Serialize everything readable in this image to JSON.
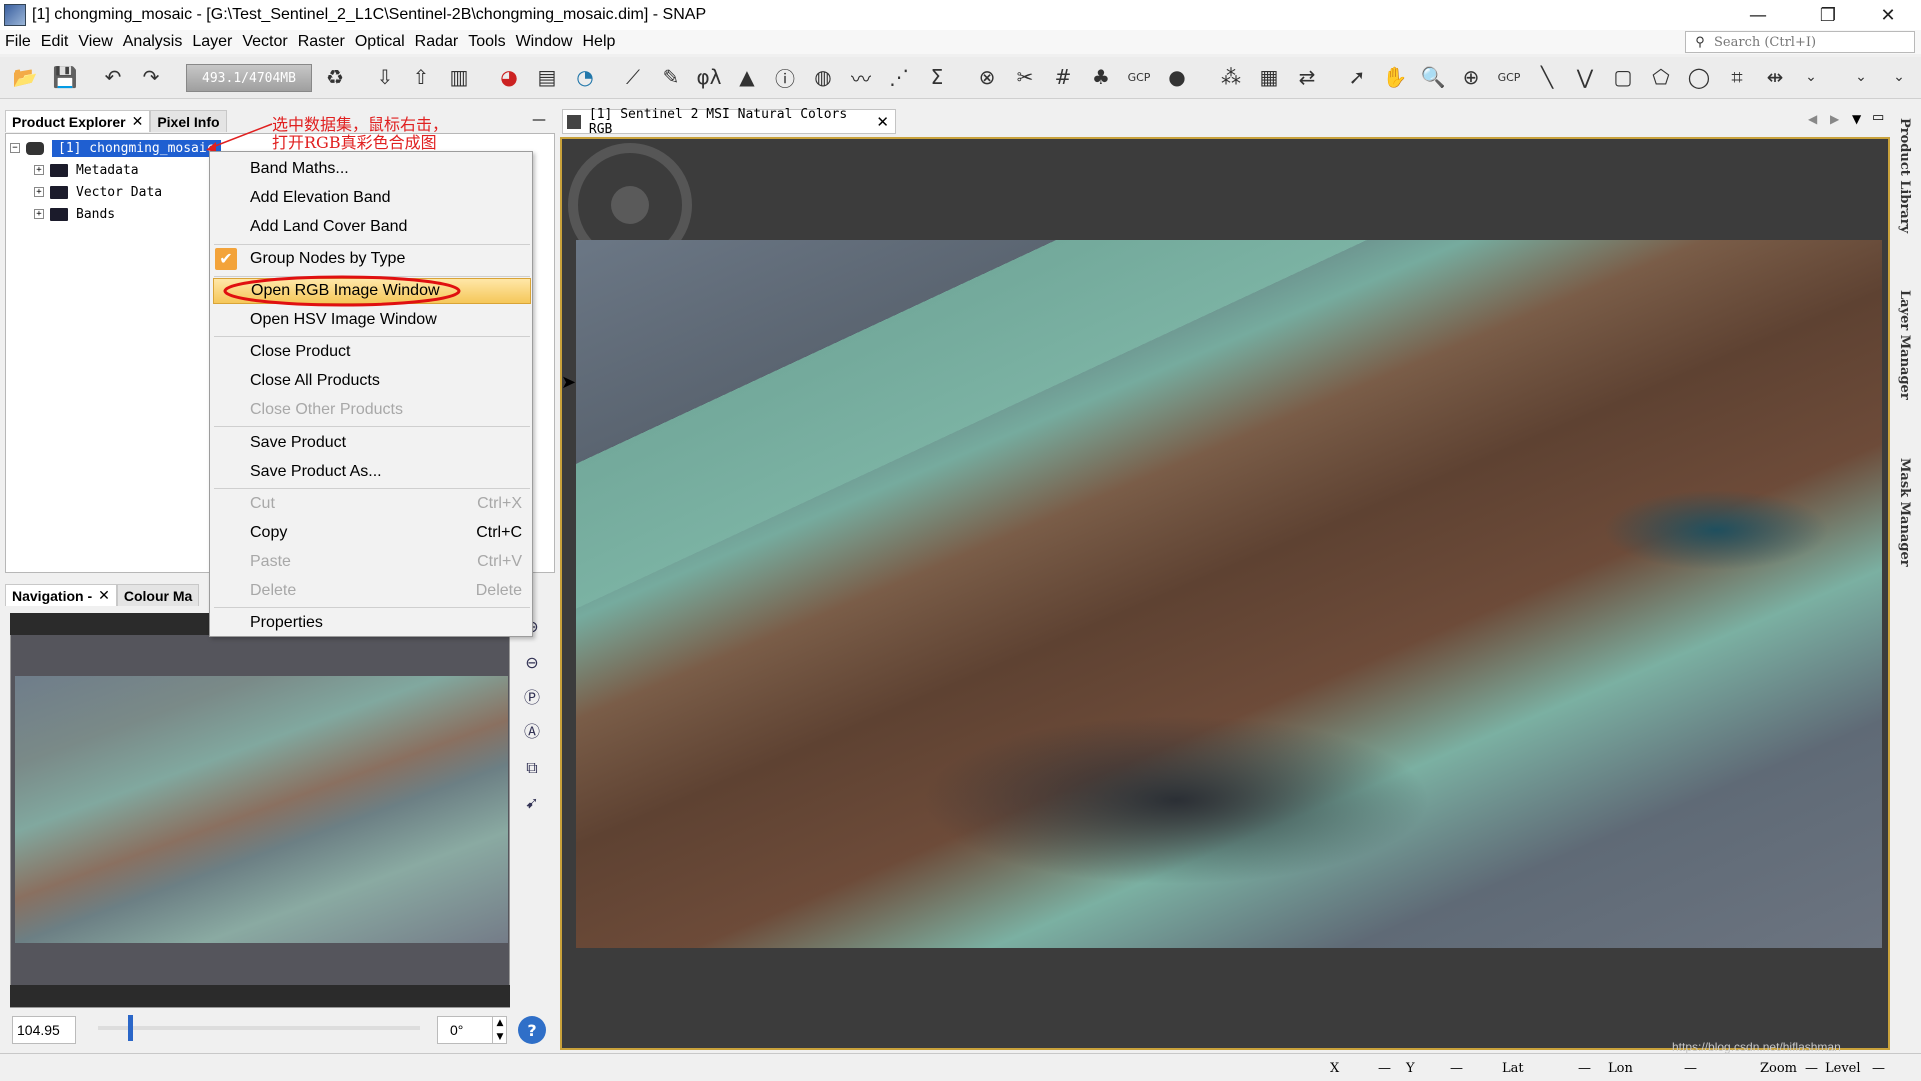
{
  "window": {
    "title": "[1] chongming_mosaic - [G:\\Test_Sentinel_2_L1C\\Sentinel-2B\\chongming_mosaic.dim] - SNAP"
  },
  "menubar": [
    "File",
    "Edit",
    "View",
    "Analysis",
    "Layer",
    "Vector",
    "Raster",
    "Optical",
    "Radar",
    "Tools",
    "Window",
    "Help"
  ],
  "search": {
    "placeholder": "Search (Ctrl+I)"
  },
  "toolbar": {
    "memory": "493.1/4704MB",
    "gcp_label": "GCP",
    "gcp_label_2": "GCP"
  },
  "explorer": {
    "tabs": [
      "Product Explorer",
      "Pixel Info"
    ],
    "product": "[1] chongming_mosaic",
    "nodes": [
      "Metadata",
      "Vector Data",
      "Bands"
    ]
  },
  "annotation": {
    "line1": "选中数据集，鼠标右击，",
    "line2": "打开RGB真彩色合成图"
  },
  "context_menu": {
    "items": [
      {
        "label": "Band Maths..."
      },
      {
        "label": "Add Elevation Band"
      },
      {
        "label": "Add Land Cover Band"
      },
      {
        "label": "Group Nodes by Type"
      },
      {
        "label": "Open RGB Image Window"
      },
      {
        "label": "Open HSV Image Window"
      },
      {
        "label": "Close Product"
      },
      {
        "label": "Close All Products"
      },
      {
        "label": "Close Other Products"
      },
      {
        "label": "Save Product"
      },
      {
        "label": "Save Product As..."
      },
      {
        "label": "Cut",
        "shortcut": "Ctrl+X"
      },
      {
        "label": "Copy",
        "shortcut": "Ctrl+C"
      },
      {
        "label": "Paste",
        "shortcut": "Ctrl+V"
      },
      {
        "label": "Delete",
        "shortcut": "Delete"
      },
      {
        "label": "Properties"
      }
    ]
  },
  "navigation": {
    "tabs": [
      "Navigation -",
      "Colour Ma"
    ],
    "zoom_value": "104.95",
    "rotation": "0°"
  },
  "image_view": {
    "tab_title": "[1] Sentinel 2 MSI Natural Colors RGB"
  },
  "right_dock": [
    "Product Library",
    "Layer Manager",
    "Mask Manager"
  ],
  "statusbar": {
    "x": "X",
    "x_val": "—",
    "y": "Y",
    "y_val": "—",
    "lat": "Lat",
    "lat_val": "—",
    "lon": "Lon",
    "lon_val": "—",
    "zoom": "Zoom",
    "zoom_val": "—",
    "level": "Level",
    "level_val": "—",
    "watermark": "https://blog.csdn.net/hiflashman"
  },
  "colors": {
    "highlight": "#f5c75a",
    "annotation": "#e02020",
    "selection_blue": "#1f5fd1"
  }
}
